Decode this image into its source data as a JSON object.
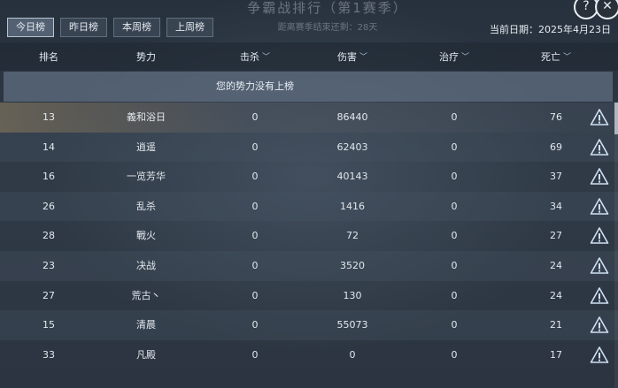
{
  "background": {
    "title": "争霸战排行（第1赛季）",
    "subtitle": "距离赛季结束还剩：28天"
  },
  "tabs": [
    {
      "label": "今日榜",
      "active": true
    },
    {
      "label": "昨日榜",
      "active": false
    },
    {
      "label": "本周榜",
      "active": false
    },
    {
      "label": "上周榜",
      "active": false
    }
  ],
  "date": {
    "text": "当前日期：2025年4月23日"
  },
  "columns": {
    "rank": "排名",
    "force": "势力",
    "kill": "击杀",
    "damage": "伤害",
    "heal": "治疗",
    "death": "死亡"
  },
  "notice": "您的势力没有上榜",
  "rows": [
    {
      "rank": "13",
      "force": "義和浴日",
      "kill": "0",
      "damage": "86440",
      "heal": "0",
      "death": "76"
    },
    {
      "rank": "14",
      "force": "逍遥",
      "kill": "0",
      "damage": "62403",
      "heal": "0",
      "death": "69"
    },
    {
      "rank": "16",
      "force": "一览芳华",
      "kill": "0",
      "damage": "40143",
      "heal": "0",
      "death": "37"
    },
    {
      "rank": "26",
      "force": "乱杀",
      "kill": "0",
      "damage": "1416",
      "heal": "0",
      "death": "34"
    },
    {
      "rank": "28",
      "force": "戰火",
      "kill": "0",
      "damage": "72",
      "heal": "0",
      "death": "27"
    },
    {
      "rank": "23",
      "force": "决战",
      "kill": "0",
      "damage": "3520",
      "heal": "0",
      "death": "24"
    },
    {
      "rank": "27",
      "force": "荒古丶",
      "kill": "0",
      "damage": "130",
      "heal": "0",
      "death": "24"
    },
    {
      "rank": "15",
      "force": "清晨",
      "kill": "0",
      "damage": "55073",
      "heal": "0",
      "death": "21"
    },
    {
      "rank": "33",
      "force": "凡殿",
      "kill": "0",
      "damage": "0",
      "heal": "0",
      "death": "17"
    }
  ],
  "icons": {
    "help": "question-icon",
    "close": "close-icon",
    "report": "warning-icon",
    "sort": "chevron-down-icon"
  },
  "colors": {
    "highlight_row": "#96846a",
    "notice_bar": "#5f6e80",
    "accent_icon": "#cfe0f2"
  }
}
